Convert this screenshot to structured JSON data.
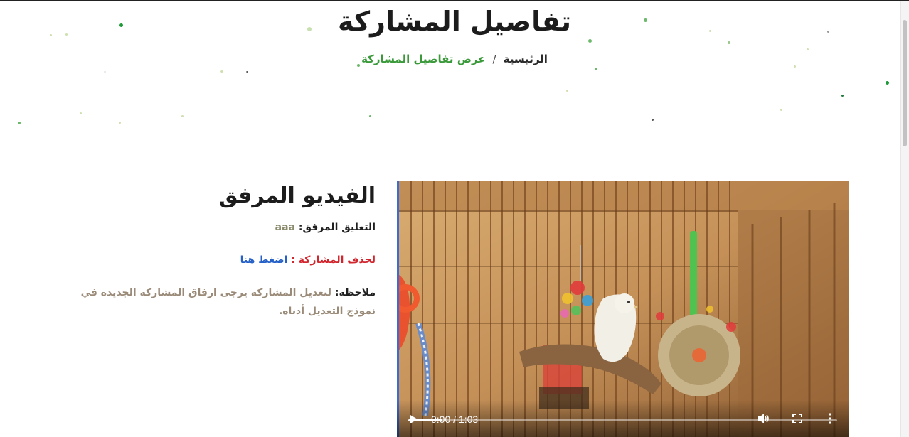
{
  "header": {
    "title": "تفاصيل المشاركة",
    "breadcrumb": {
      "home": "الرئيسية",
      "separator": "/",
      "current": "عرض تفاصيل المشاركة"
    }
  },
  "attachment": {
    "section_title": "الفيديو المرفق",
    "comment_label": "التعليق المرفق:",
    "comment_value": "aaa",
    "delete_label": "لحذف المشاركة :",
    "delete_link": "اضغط هنا",
    "note_label": "ملاحظة:",
    "note_text": "لتعديل المشاركة يرجى ارفاق المشاركة الجديدة في نموذج التعديل أدناه."
  },
  "video": {
    "time": "0:00 / 1:03",
    "progress": 0.08,
    "play_icon": "play-icon",
    "volume_icon": "volume-icon",
    "fullscreen_icon": "fullscreen-icon",
    "menu_icon": "more-vert-icon"
  },
  "colors": {
    "accent_green": "#3a9a3a",
    "delete_red": "#d2262e",
    "link_blue": "#2460c8"
  }
}
